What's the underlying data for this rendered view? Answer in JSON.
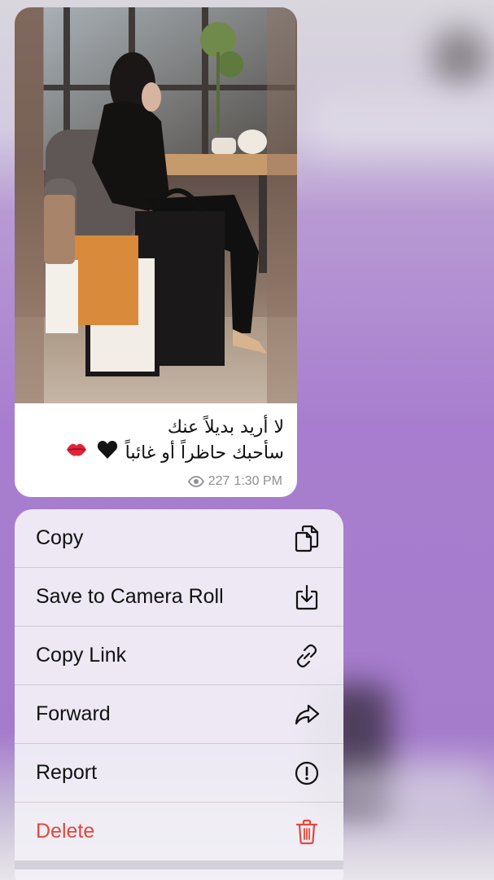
{
  "message": {
    "caption_lines": [
      "لا أريد بديلاً عنك",
      "سأحبك حاظراً أو غائباً"
    ],
    "emoji": [
      "black-heart",
      "kiss-mark"
    ],
    "views": "227",
    "time": "1:30 PM"
  },
  "context_menu": {
    "items": [
      {
        "label": "Copy",
        "icon": "copy-icon"
      },
      {
        "label": "Save to Camera Roll",
        "icon": "save-icon"
      },
      {
        "label": "Copy Link",
        "icon": "link-icon"
      },
      {
        "label": "Forward",
        "icon": "forward-icon"
      },
      {
        "label": "Report",
        "icon": "report-icon"
      },
      {
        "label": "Delete",
        "icon": "trash-icon"
      }
    ]
  },
  "colors": {
    "danger": "#e5473c",
    "menu_background": "#f2f0f6",
    "chat_background": "#a87dcf"
  }
}
